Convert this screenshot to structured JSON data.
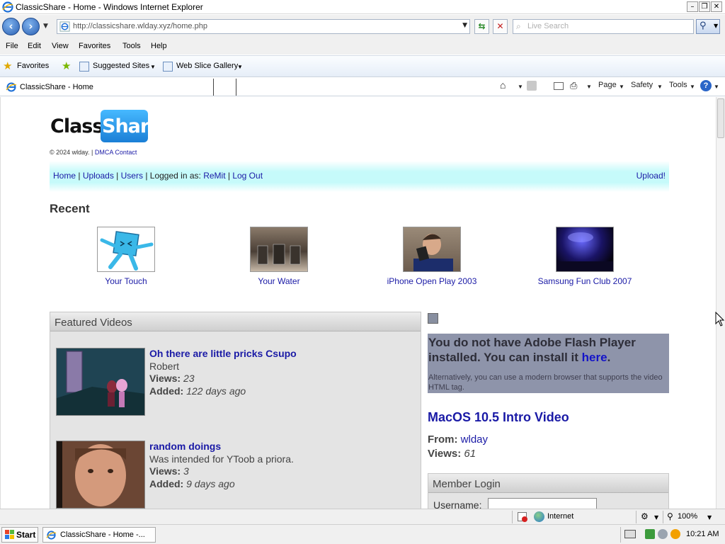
{
  "window": {
    "title": "ClassicShare - Home - Windows Internet Explorer",
    "minimize": "–",
    "restore": "❐",
    "close": "✕"
  },
  "addressbar": {
    "url": "http://classicshare.wlday.xyz/home.php",
    "search_placeholder": "Live Search"
  },
  "menu": {
    "items": [
      "File",
      "Edit",
      "View",
      "Favorites",
      "Tools",
      "Help"
    ]
  },
  "favorites_bar": {
    "favorites_label": "Favorites",
    "suggested_sites": "Suggested Sites",
    "web_slice_gallery": "Web Slice Gallery"
  },
  "tabs": {
    "active_label": "ClassicShare - Home",
    "page_menu": "Page",
    "safety_menu": "Safety",
    "tools_menu": "Tools"
  },
  "site": {
    "logo_part1": "Classic",
    "logo_part2": "Share",
    "copyright": "© 2024 wlday.  |",
    "dmca_link": "DMCA Contact",
    "nav": {
      "home": "Home",
      "uploads": "Uploads",
      "users": "Users",
      "logged_in_as": "Logged in as:",
      "username": "ReMit",
      "logout": "Log Out",
      "upload": "Upload!"
    },
    "recent_heading": "Recent",
    "recent": [
      {
        "title": "Your Touch"
      },
      {
        "title": "Your Water"
      },
      {
        "title": "iPhone Open Play 2003"
      },
      {
        "title": "Samsung Fun Club 2007"
      }
    ],
    "featured_heading": "Featured Videos",
    "featured": [
      {
        "title": "Oh there are little pricks Csupo",
        "desc": "Robert",
        "views_label": "Views:",
        "views": "23",
        "added_label": "Added:",
        "added": "122 days ago"
      },
      {
        "title": "random doings",
        "desc": "Was intended for YToob a priora.",
        "views_label": "Views:",
        "views": "3",
        "added_label": "Added:",
        "added": "9 days ago"
      }
    ],
    "flash": {
      "line1": "You do not have Adobe Flash Player installed. You can install it",
      "here": "here",
      "period": ".",
      "alt": "Alternatively, you can use a modern browser that supports the video HTML tag."
    },
    "player": {
      "title": "MacOS 10.5 Intro Video",
      "from_label": "From:",
      "from": "wlday",
      "views_label": "Views:",
      "views": "61"
    },
    "login": {
      "heading": "Member Login",
      "username_label": "Username:"
    }
  },
  "statusbar": {
    "zone": "Internet",
    "zoom": "100%"
  },
  "taskbar": {
    "start": "Start",
    "item": "ClassicShare - Home -...",
    "clock": "10:21 AM"
  }
}
